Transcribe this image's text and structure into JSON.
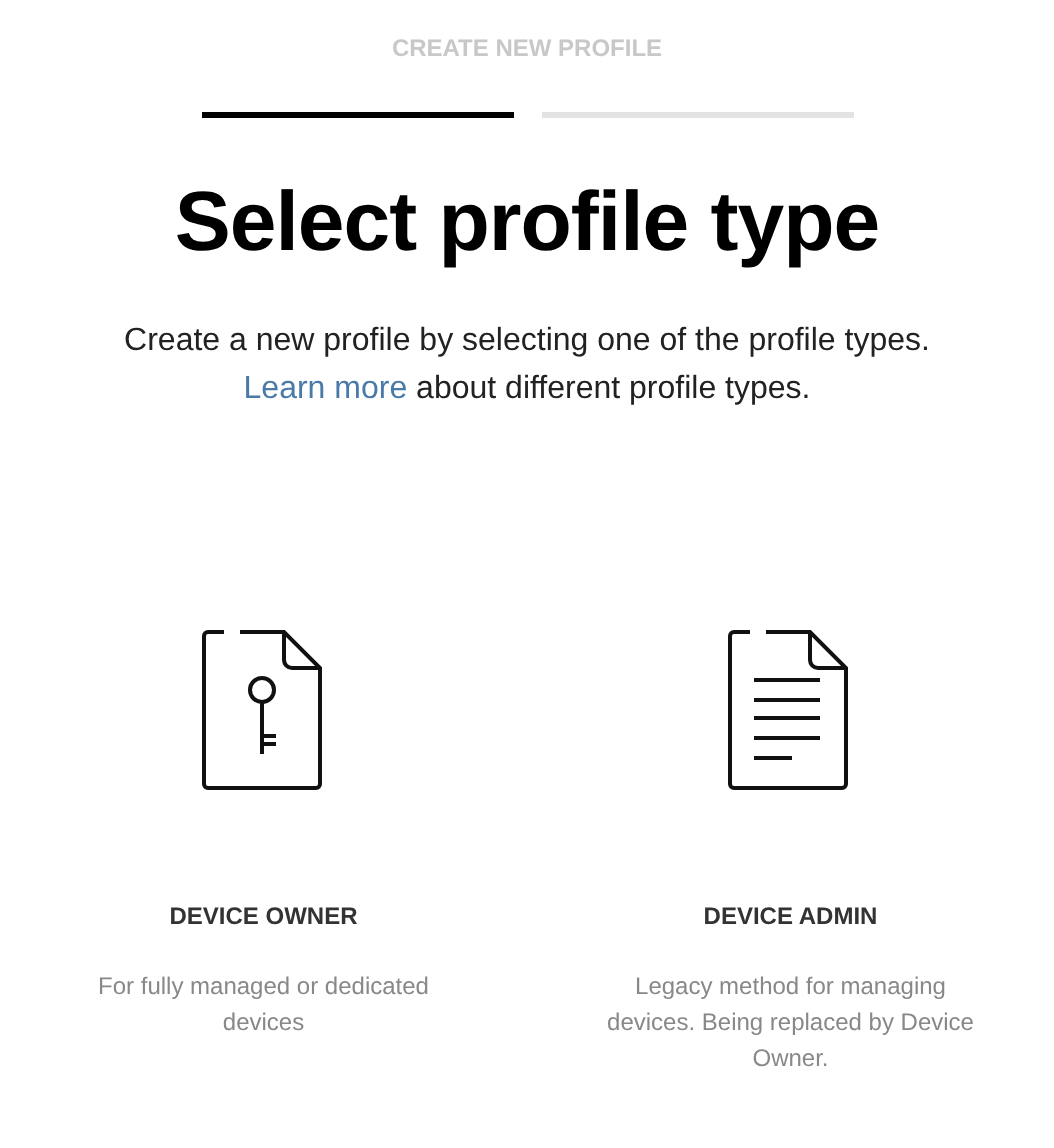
{
  "header": "CREATE NEW PROFILE",
  "steps": [
    {
      "active": true
    },
    {
      "active": false
    }
  ],
  "title": "Select profile type",
  "intro": {
    "before": "Create a new profile by selecting one of the profile types.",
    "link": "Learn more",
    "after": "about different profile types."
  },
  "profile_types": [
    {
      "kind": "key",
      "label": "DEVICE OWNER",
      "description": "For fully managed or dedicated devices"
    },
    {
      "kind": "document",
      "label": "DEVICE ADMIN",
      "description": "Legacy method for managing devices. Being replaced by Device Owner."
    }
  ]
}
